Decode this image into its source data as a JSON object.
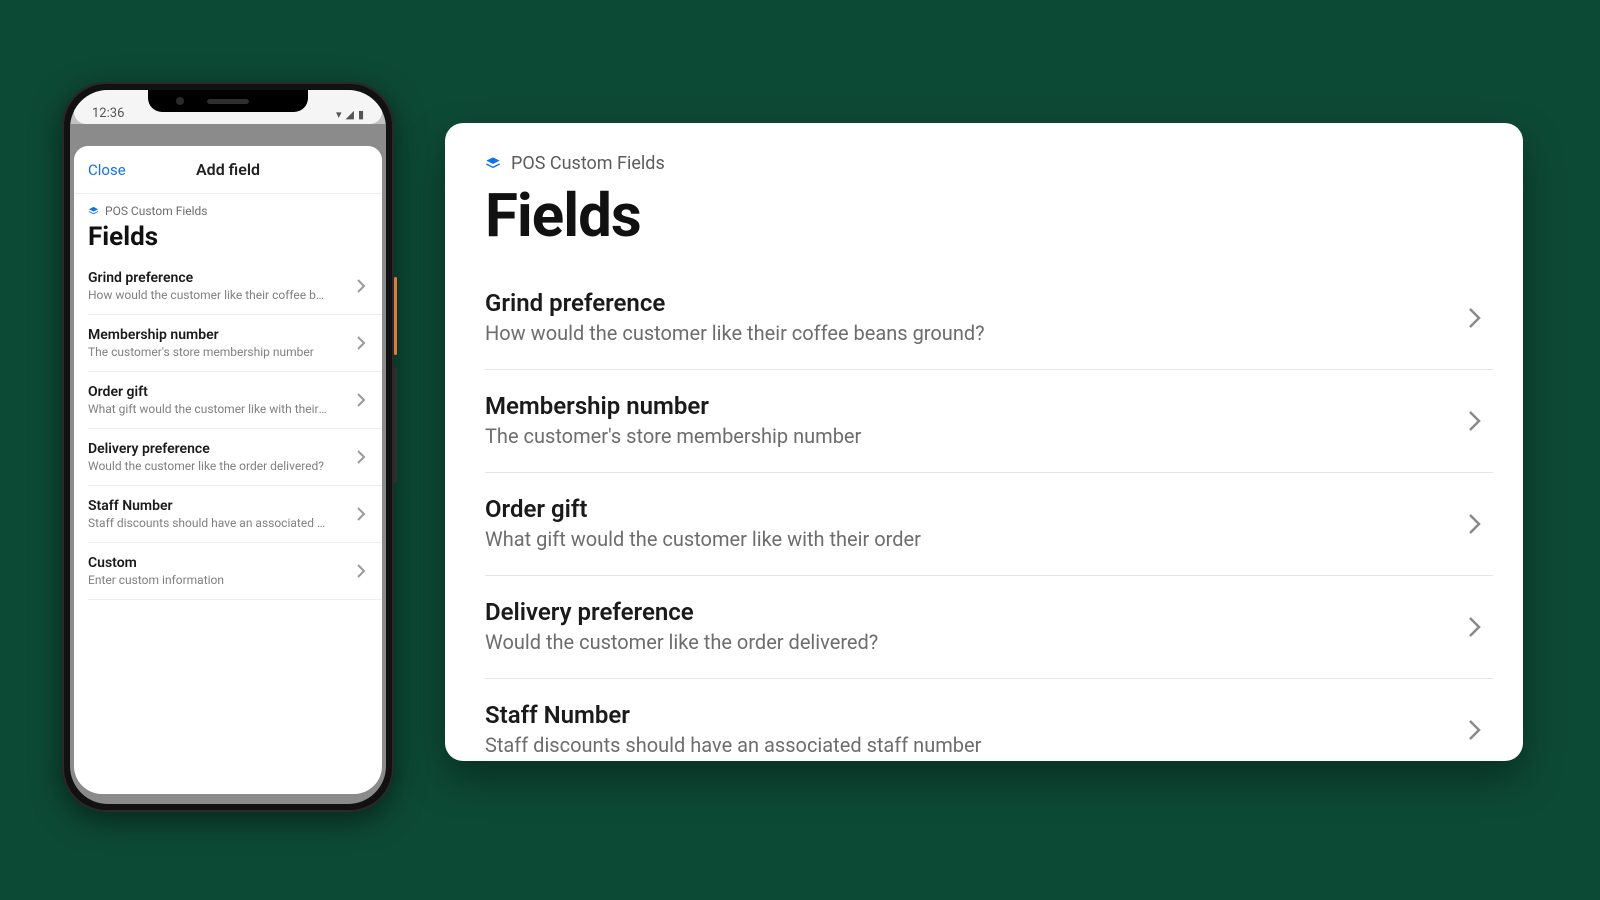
{
  "phone": {
    "status_time": "12:36",
    "modal": {
      "close_label": "Close",
      "title": "Add field"
    },
    "app_tag": "POS Custom Fields",
    "page_title": "Fields",
    "items": [
      {
        "title": "Grind preference",
        "desc": "How would the customer like their coffee bean…"
      },
      {
        "title": "Membership number",
        "desc": "The customer's store membership number"
      },
      {
        "title": "Order gift",
        "desc": "What gift would the customer like with their order"
      },
      {
        "title": "Delivery preference",
        "desc": "Would the customer like the order delivered?"
      },
      {
        "title": "Staff Number",
        "desc": "Staff discounts should have an associated sta…"
      },
      {
        "title": "Custom",
        "desc": "Enter custom information"
      }
    ]
  },
  "card": {
    "app_tag": "POS Custom Fields",
    "page_title": "Fields",
    "items": [
      {
        "title": "Grind preference",
        "desc": "How would the customer like their coffee beans ground?"
      },
      {
        "title": "Membership number",
        "desc": "The customer's store membership number"
      },
      {
        "title": "Order gift",
        "desc": "What gift would the customer like with their order"
      },
      {
        "title": "Delivery preference",
        "desc": "Would the customer like the order delivered?"
      },
      {
        "title": "Staff Number",
        "desc": "Staff discounts should have an associated staff number"
      }
    ]
  }
}
